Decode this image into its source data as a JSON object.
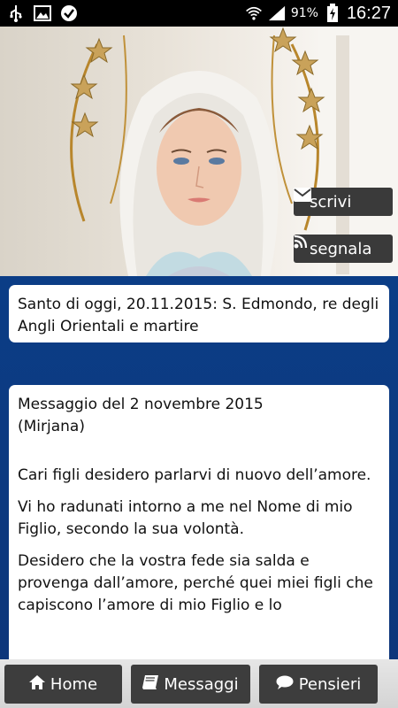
{
  "status_bar": {
    "battery_percent": "91%",
    "time": "16:27",
    "left_icons": [
      "usb-icon",
      "image-icon",
      "check-badge-icon"
    ],
    "right_icons": [
      "wifi-icon",
      "signal-icon",
      "battery-charging-icon"
    ]
  },
  "hero": {
    "scrivi_label": "scrivi",
    "segnala_label": "segnala"
  },
  "santo": {
    "text": "Santo di oggi, 20.11.2015: S. Edmondo, re degli Angli Orientali e martire"
  },
  "message": {
    "title": "Messaggio del 2 novembre 2015",
    "author": "(Mirjana)",
    "paragraphs": [
      "Cari figli desidero parlarvi di nuovo dell’amore.",
      "Vi ho radunati intorno a me nel Nome di mio Figlio, secondo la sua volontà.",
      "Desidero che la vostra fede sia salda e provenga dall’amore, perché quei miei figli che capiscono l’amore di mio Figlio e lo"
    ]
  },
  "bottom_nav": {
    "home_label": "Home",
    "messaggi_label": "Messaggi",
    "pensieri_label": "Pensieri"
  },
  "colors": {
    "background_blue": "#0b3d86",
    "button_dark": "#3d3d3d",
    "card_white": "#ffffff"
  }
}
